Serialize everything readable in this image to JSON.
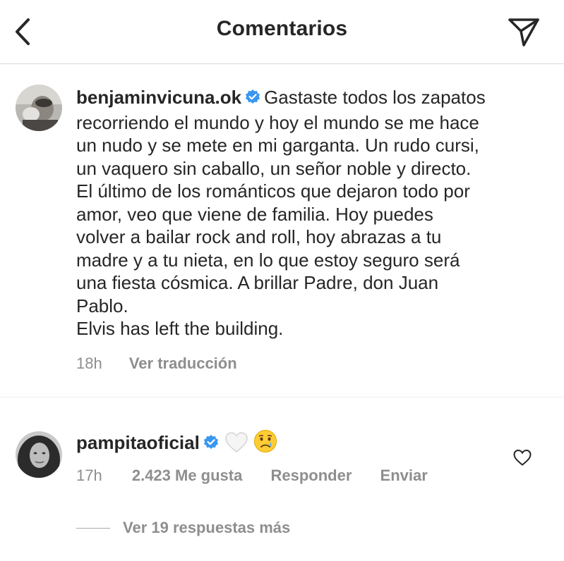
{
  "header": {
    "title": "Comentarios",
    "back_icon": "chevron-left-icon",
    "send_icon": "paper-plane-icon"
  },
  "comments": [
    {
      "username": "benjaminvicuna.ok",
      "verified": true,
      "lines": [
        "Gastaste todos los zapatos",
        "recorriendo el mundo y hoy el mundo se me hace",
        "un nudo y se mete en mi garganta. Un rudo cursi,",
        "un vaquero sin caballo, un señor noble y directo.",
        "El último de los románticos que dejaron todo por",
        "amor, veo que viene de familia. Hoy puedes",
        "volver a bailar rock and roll, hoy abrazas a tu",
        "madre y a tu nieta, en lo que estoy seguro será",
        "una fiesta cósmica. A brillar Padre, don Juan",
        "Pablo.",
        "Elvis has left the building."
      ],
      "time": "18h",
      "translate_label": "Ver traducción"
    },
    {
      "username": "pampitaoficial",
      "verified": true,
      "emojis": [
        "white-heart-emoji",
        "crying-face-emoji"
      ],
      "time": "17h",
      "likes_label": "2.423 Me gusta",
      "reply_label": "Responder",
      "send_label": "Enviar",
      "view_replies_label": "Ver 19 respuestas más"
    }
  ],
  "colors": {
    "text": "#262626",
    "secondary": "#8e8e8e",
    "verified_blue": "#3897f0",
    "divider": "#efefef"
  }
}
